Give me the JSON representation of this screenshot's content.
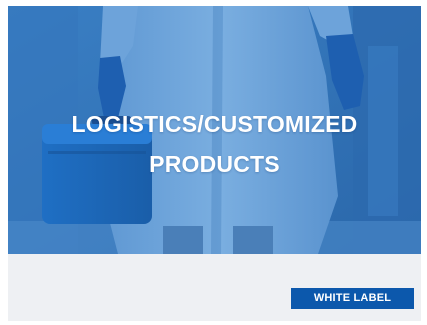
{
  "card": {
    "title_line1": "LOGISTICS/CUSTOMIZED",
    "title_line2": "PRODUCTS",
    "badge_label": "WHITE LABEL",
    "hero_image": "person-in-lab-coat-holding-blue-cooler-box",
    "colors": {
      "hero_overlay": "#2f72b8",
      "badge_background": "#0c58ac",
      "card_background": "#eef0f3",
      "text": "#ffffff"
    }
  }
}
